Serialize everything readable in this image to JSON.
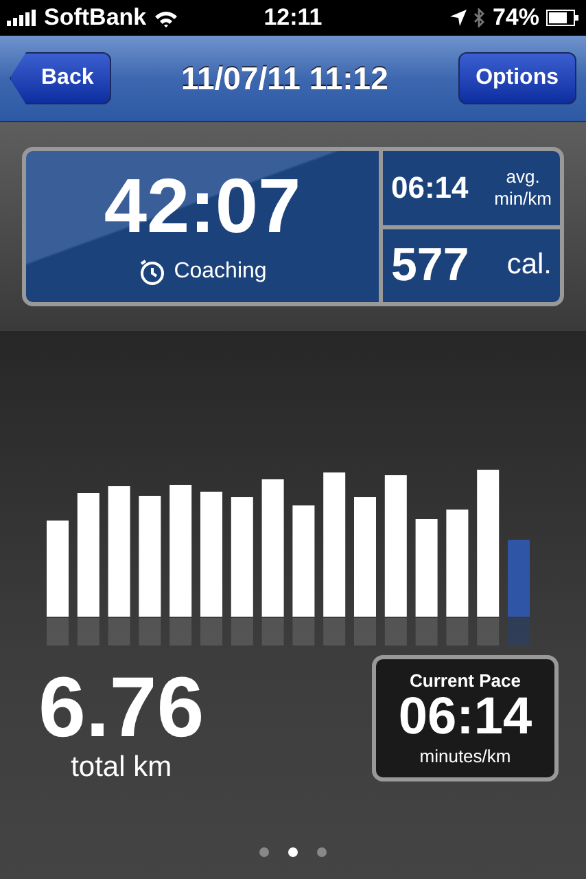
{
  "status_bar": {
    "carrier": "SoftBank",
    "time": "12:11",
    "battery": "74%"
  },
  "nav_bar": {
    "back": "Back",
    "title": "11/07/11 11:12",
    "options": "Options"
  },
  "stats": {
    "duration": "42:07",
    "coaching": "Coaching",
    "pace": "06:14",
    "pace_unit_1": "avg.",
    "pace_unit_2": "min/km",
    "calories": "577",
    "calories_unit": "cal."
  },
  "distance": {
    "value": "6.76",
    "label": "total km"
  },
  "current_pace": {
    "title": "Current Pace",
    "value": "06:14",
    "unit": "minutes/km"
  },
  "pages": [
    {
      "selected": false
    },
    {
      "selected": true
    },
    {
      "selected": false
    }
  ]
}
